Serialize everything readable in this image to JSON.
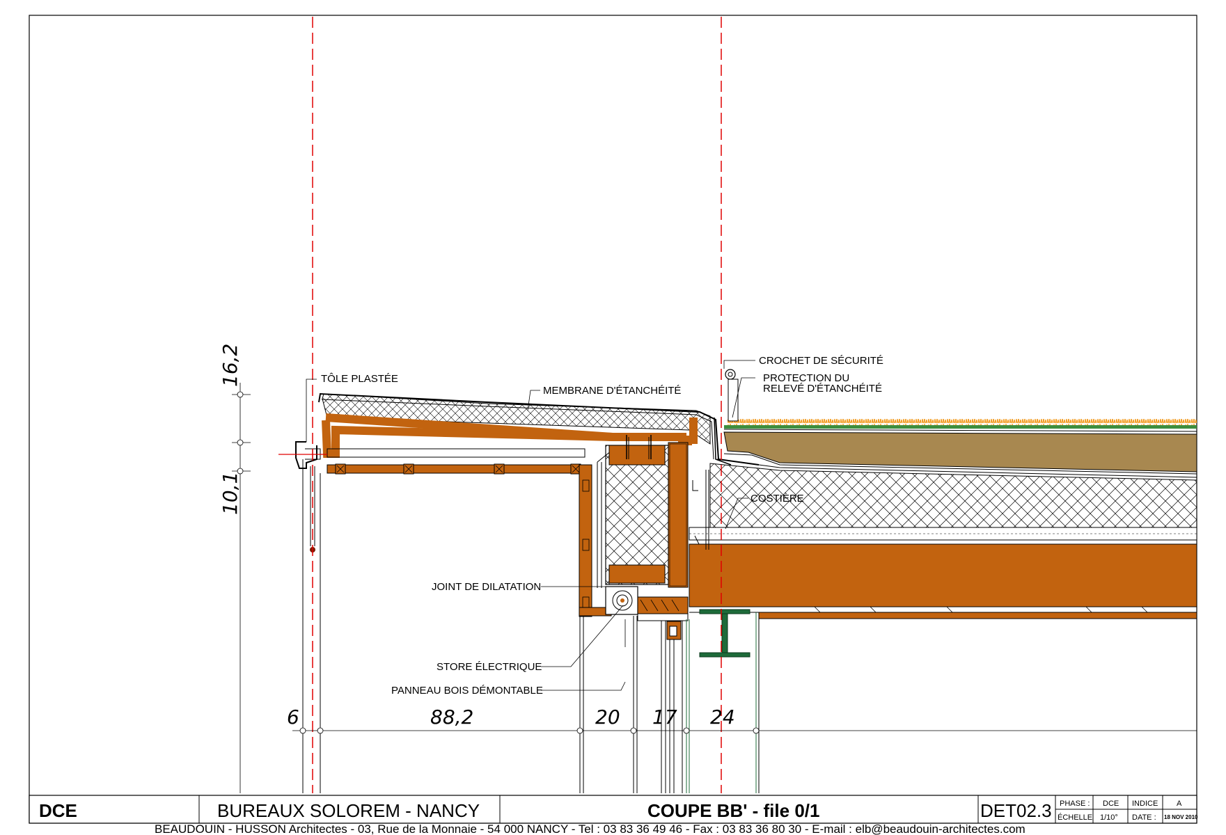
{
  "labels": {
    "tole": "TÔLE PLASTÉE",
    "membrane": "MEMBRANE D'ÉTANCHÉITÉ",
    "crochet": "CROCHET DE SÉCURITÉ",
    "protection_1": "PROTECTION DU",
    "protection_2": "RELEVÉ D'ÉTANCHÉITÉ",
    "costiere": "COSTIÈRE",
    "joint": "JOINT DE DILATATION",
    "store": "STORE ÉLECTRIQUE",
    "panneau": "PANNEAU BOIS DÉMONTABLE"
  },
  "dimensions": {
    "horizontal": [
      "6",
      "88,2",
      "20",
      "17",
      "24"
    ],
    "vertical": [
      "16,2",
      "10,1"
    ]
  },
  "title_block": {
    "phase_code": "DCE",
    "project": "BUREAUX SOLOREM - NANCY",
    "drawing_title": "COUPE BB' - file 0/1",
    "sheet_number": "DET02.3",
    "phase_label": "PHASE :",
    "phase_value": "DCE",
    "indice_label": "INDICE",
    "indice_value": "A",
    "echelle_label": "ÉCHELLE",
    "echelle_value": "1/10°",
    "date_label": "DATE :",
    "date_value": "18 NOV 2010"
  },
  "footer": "BEAUDOUIN - HUSSON  Architectes - 03, Rue de la Monnaie - 54 000  NANCY - Tel : 03 83 36 49 46 - Fax : 03 83 36 80 30 - E-mail : elb@beaudouin-architectes.com",
  "colors": {
    "wood": "#C2630F",
    "soil": "#A88850",
    "grass": "#3E8E3E",
    "flowers": "#F29A1E",
    "axis": "#E00000",
    "steel": "#1E6B3A"
  }
}
